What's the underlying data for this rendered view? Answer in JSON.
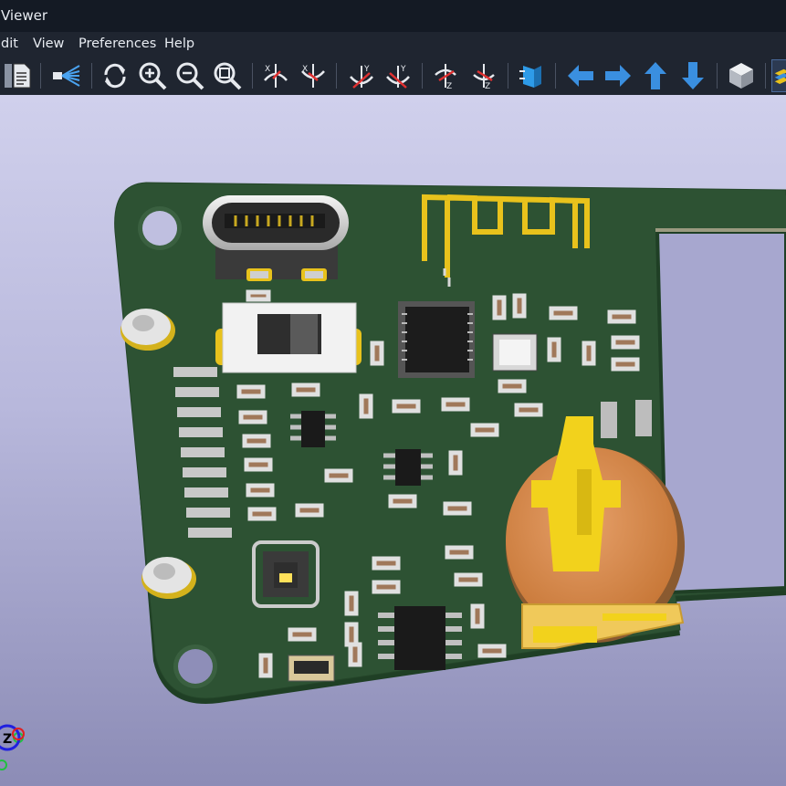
{
  "window": {
    "title": "Viewer"
  },
  "menu": {
    "items": [
      "dit",
      "View",
      "Preferences",
      "Help"
    ]
  },
  "toolbar": {
    "buttons": [
      "page-setup-icon",
      "raytrace-icon",
      "reload-icon",
      "zoom-in-icon",
      "zoom-out-icon",
      "zoom-fit-icon",
      "rotate-x-cw-icon",
      "rotate-x-ccw-icon",
      "rotate-y-cw-icon",
      "rotate-y-ccw-icon",
      "rotate-z-cw-icon",
      "rotate-z-ccw-icon",
      "flip-board-icon",
      "move-left-icon",
      "move-right-icon",
      "move-up-icon",
      "move-down-icon",
      "ortho-view-icon",
      "layers-icon"
    ]
  },
  "colors": {
    "background_top": "#d0d0ec",
    "background_bottom": "#8c8cb6",
    "board_soldermask": "#2d5233",
    "copper_gold": "#e8c21c",
    "toolbar_arrow": "#3a8fe0",
    "axis_x": "#e02020",
    "axis_y": "#20c040",
    "axis_z": "#2020e0"
  },
  "axis": {
    "label": "Z"
  }
}
